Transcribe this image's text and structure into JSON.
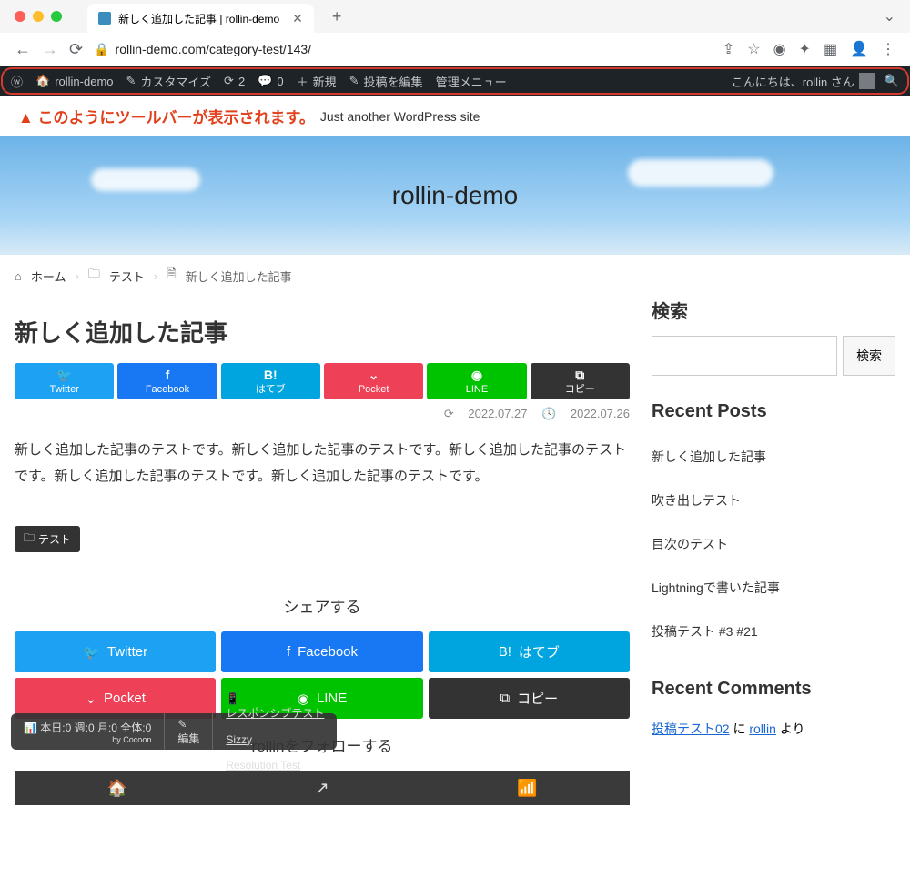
{
  "browser": {
    "tab_title": "新しく追加した記事 | rollin-demo",
    "url": "rollin-demo.com/category-test/143/"
  },
  "adminbar": {
    "site_name": "rollin-demo",
    "customize": "カスタマイズ",
    "updates": "2",
    "comments": "0",
    "new": "新規",
    "edit_post": "投稿を編集",
    "admin_menu": "管理メニュー",
    "greeting": "こんにちは、rollin さん"
  },
  "annotation": {
    "warning": "▲ このようにツールバーが表示されます。",
    "tagline": "Just another WordPress site"
  },
  "site_title": "rollin-demo",
  "breadcrumb": {
    "home": "ホーム",
    "cat": "テスト",
    "page": "新しく追加した記事"
  },
  "article": {
    "title": "新しく追加した記事",
    "share": {
      "twitter": "Twitter",
      "facebook": "Facebook",
      "hatena": "はてブ",
      "hatena_icon": "B!",
      "pocket": "Pocket",
      "line": "LINE",
      "copy": "コピー"
    },
    "date_published": "2022.07.27",
    "date_modified": "2022.07.26",
    "body": "新しく追加した記事のテストです。新しく追加した記事のテストです。新しく追加した記事のテストです。新しく追加した記事のテストです。新しく追加した記事のテストです。",
    "category": "テスト",
    "share_heading": "シェアする",
    "follow_heading": "rollinをフォローする"
  },
  "sidebar": {
    "search_title": "検索",
    "search_button": "検索",
    "recent_title": "Recent Posts",
    "recent": [
      "新しく追加した記事",
      "吹き出しテスト",
      "目次のテスト",
      "Lightningで書いた記事",
      "投稿テスト #3 #21"
    ],
    "comments_title": "Recent Comments",
    "comment1_post": "投稿テスト02",
    "comment1_sep": " に ",
    "comment1_author": "rollin",
    "comment1_tail": " より"
  },
  "stats": {
    "counts": "本日:0 週:0 月:0 全体:0",
    "by": "by Cocoon",
    "edit": "編集",
    "responsive": "レスポンシブテスト",
    "sizzy": "Sizzy",
    "restest": "Resolution Test"
  }
}
